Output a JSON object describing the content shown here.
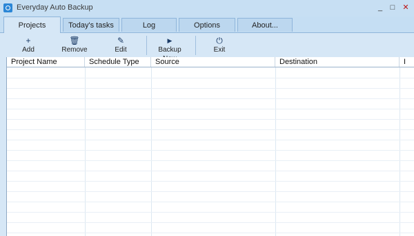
{
  "window": {
    "title": "Everyday Auto Backup",
    "minimize": "_",
    "maximize": "□",
    "close": "✕"
  },
  "tabs": [
    {
      "label": "Projects",
      "active": true
    },
    {
      "label": "Today's tasks"
    },
    {
      "label": "Log"
    },
    {
      "label": "Options"
    },
    {
      "label": "About..."
    }
  ],
  "toolbar": {
    "add": {
      "label": "Add",
      "icon": "plus-icon",
      "glyph": "+"
    },
    "remove": {
      "label": "Remove",
      "icon": "trash-icon",
      "glyph": "🗑"
    },
    "edit": {
      "label": "Edit",
      "icon": "pencil-icon",
      "glyph": "✎"
    },
    "backup_now": {
      "label": "Backup Now",
      "icon": "play-icon",
      "glyph": "▶"
    },
    "exit": {
      "label": "Exit",
      "icon": "power-icon",
      "glyph": "⏻"
    }
  },
  "grid": {
    "columns": [
      "Project Name",
      "Schedule Type",
      "Source",
      "Destination",
      "I"
    ],
    "rows": []
  },
  "colors": {
    "background": "#c5def3",
    "panel": "#d6e7f6",
    "accent": "#2b86d6"
  }
}
